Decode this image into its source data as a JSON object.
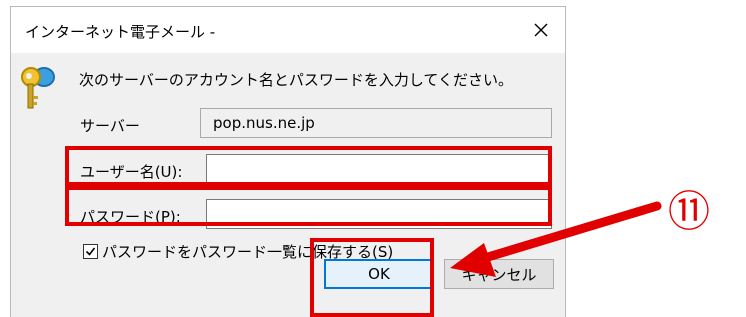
{
  "dialog": {
    "title": "インターネット電子メール -",
    "message": "次のサーバーのアカウント名とパスワードを入力してください。",
    "server_label": "サーバー",
    "server_value": "pop.nus.ne.jp",
    "username_label": "ユーザー名(U):",
    "username_value": "",
    "password_label": "パスワード(P):",
    "password_value": "",
    "save_password_label": "パスワードをパスワード一覧に保存する(S)",
    "save_password_checked": true,
    "ok_label": "OK",
    "cancel_label": "キャンセル"
  },
  "annotation": {
    "step_number": "⑪",
    "highlight_color": "#e10000"
  },
  "icons": {
    "close": "close-icon",
    "keys": "keys-icon",
    "check": "checkmark-icon",
    "arrow": "arrow-icon"
  }
}
